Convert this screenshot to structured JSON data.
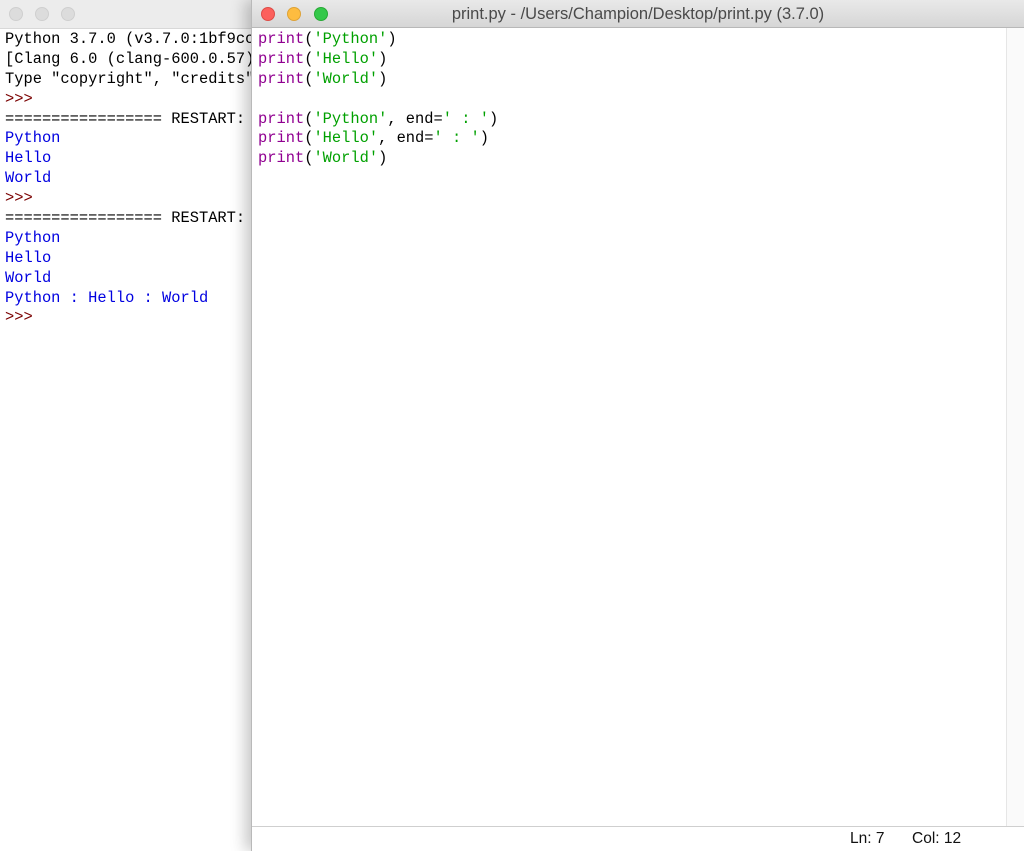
{
  "shell": {
    "lines": [
      {
        "text": "Python 3.7.0 (v3.7.0:1bf9cc",
        "kind": "plain"
      },
      {
        "text": "[Clang 6.0 (clang-600.0.57)",
        "kind": "plain"
      },
      {
        "text": "Type \"copyright\", \"credits\"",
        "kind": "plain"
      },
      {
        "text": ">>>",
        "kind": "prompt"
      },
      {
        "text": "================= RESTART:",
        "kind": "plain"
      },
      {
        "text": "Python",
        "kind": "out"
      },
      {
        "text": "Hello",
        "kind": "out"
      },
      {
        "text": "World",
        "kind": "out"
      },
      {
        "text": ">>>",
        "kind": "prompt"
      },
      {
        "text": "================= RESTART:",
        "kind": "plain"
      },
      {
        "text": "Python",
        "kind": "out"
      },
      {
        "text": "Hello",
        "kind": "out"
      },
      {
        "text": "World",
        "kind": "out"
      },
      {
        "text": "Python : Hello : World",
        "kind": "out"
      },
      {
        "text": ">>>",
        "kind": "prompt"
      }
    ]
  },
  "editor": {
    "title": "print.py - /Users/Champion/Desktop/print.py (3.7.0)",
    "code": [
      {
        "kw": "print",
        "open": "(",
        "str": "'Python'",
        "rest": ")",
        "end_label": "",
        "end_str": "",
        "close": ""
      },
      {
        "kw": "print",
        "open": "(",
        "str": "'Hello'",
        "rest": ")",
        "end_label": "",
        "end_str": "",
        "close": ""
      },
      {
        "kw": "print",
        "open": "(",
        "str": "'World'",
        "rest": ")",
        "end_label": "",
        "end_str": "",
        "close": ""
      },
      {
        "blank": true
      },
      {
        "kw": "print",
        "open": "(",
        "str": "'Python'",
        "rest": ", end=",
        "end_str": "' : '",
        "close": ")"
      },
      {
        "kw": "print",
        "open": "(",
        "str": "'Hello'",
        "rest": ", end=",
        "end_str": "' : '",
        "close": ")"
      },
      {
        "kw": "print",
        "open": "(",
        "str": "'World'",
        "rest": ")",
        "end_str": "",
        "close": ""
      }
    ],
    "status": {
      "ln": "Ln: 7",
      "col": "Col: 12"
    }
  },
  "colors": {
    "keyword": "#900090",
    "string": "#00a000",
    "output": "#0000e0",
    "prompt": "#7a0000"
  }
}
